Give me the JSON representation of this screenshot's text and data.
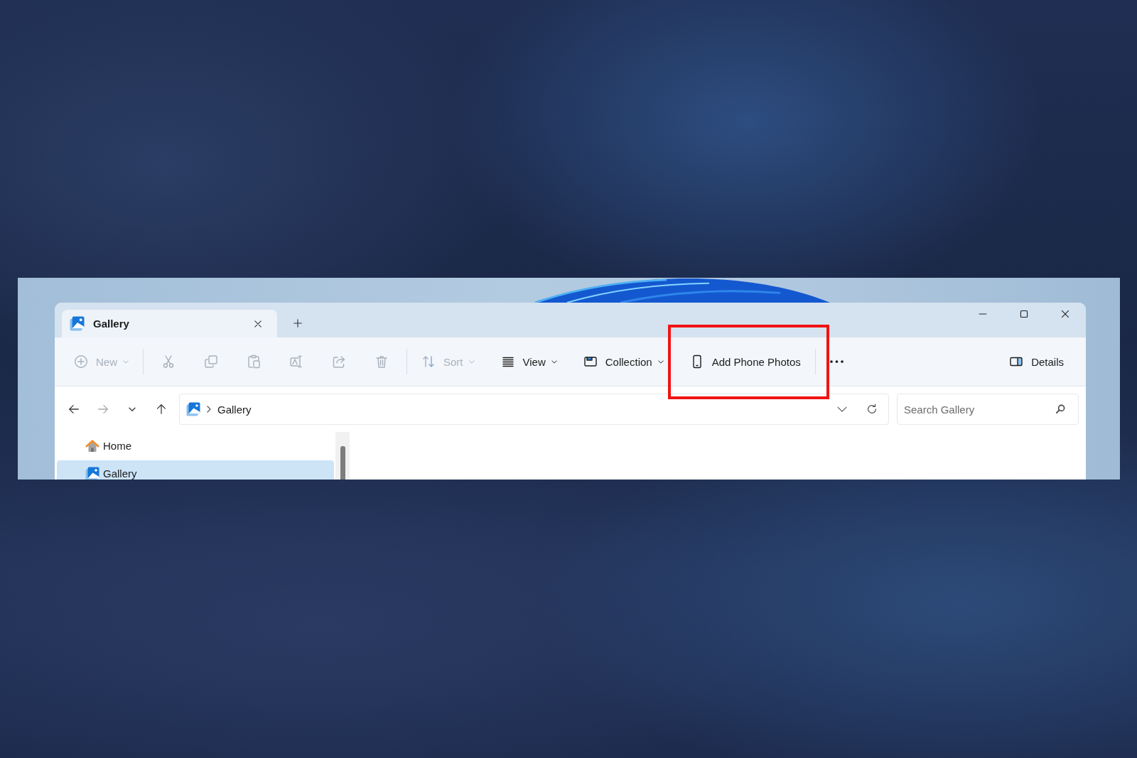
{
  "tabs": [
    {
      "label": "Gallery",
      "selected": true
    }
  ],
  "toolbar": {
    "items": [
      {
        "kind": "menu",
        "label": "New",
        "disabled": true,
        "highlighted": false
      },
      {
        "kind": "separator"
      },
      {
        "kind": "icon",
        "disabled": true,
        "highlighted": false
      },
      {
        "kind": "icon",
        "disabled": true,
        "highlighted": false
      },
      {
        "kind": "icon",
        "disabled": true,
        "highlighted": false
      },
      {
        "kind": "icon",
        "disabled": true,
        "highlighted": false
      },
      {
        "kind": "icon",
        "disabled": true,
        "highlighted": false
      },
      {
        "kind": "icon",
        "disabled": true,
        "highlighted": false
      },
      {
        "kind": "separator"
      },
      {
        "kind": "menu",
        "label": "Sort",
        "disabled": true,
        "highlighted": false
      },
      {
        "kind": "menu",
        "label": "View",
        "disabled": false,
        "highlighted": false
      },
      {
        "kind": "menu",
        "label": "Collection",
        "disabled": false,
        "highlighted": false
      },
      {
        "kind": "button",
        "label": "Add Phone Photos",
        "disabled": false,
        "highlighted": true
      },
      {
        "kind": "separator"
      },
      {
        "kind": "more",
        "disabled": false,
        "highlighted": false
      }
    ],
    "details": {
      "label": "Details"
    }
  },
  "navigation": [
    {
      "disabled": false
    },
    {
      "disabled": true
    },
    {
      "disabled": false
    },
    {
      "disabled": false
    }
  ],
  "address_bar": {
    "path": [
      "Gallery"
    ]
  },
  "search": {
    "placeholder": "Search Gallery"
  },
  "sidebar": {
    "items": [
      {
        "label": "Home",
        "selected": false
      },
      {
        "label": "Gallery",
        "selected": true
      }
    ]
  }
}
